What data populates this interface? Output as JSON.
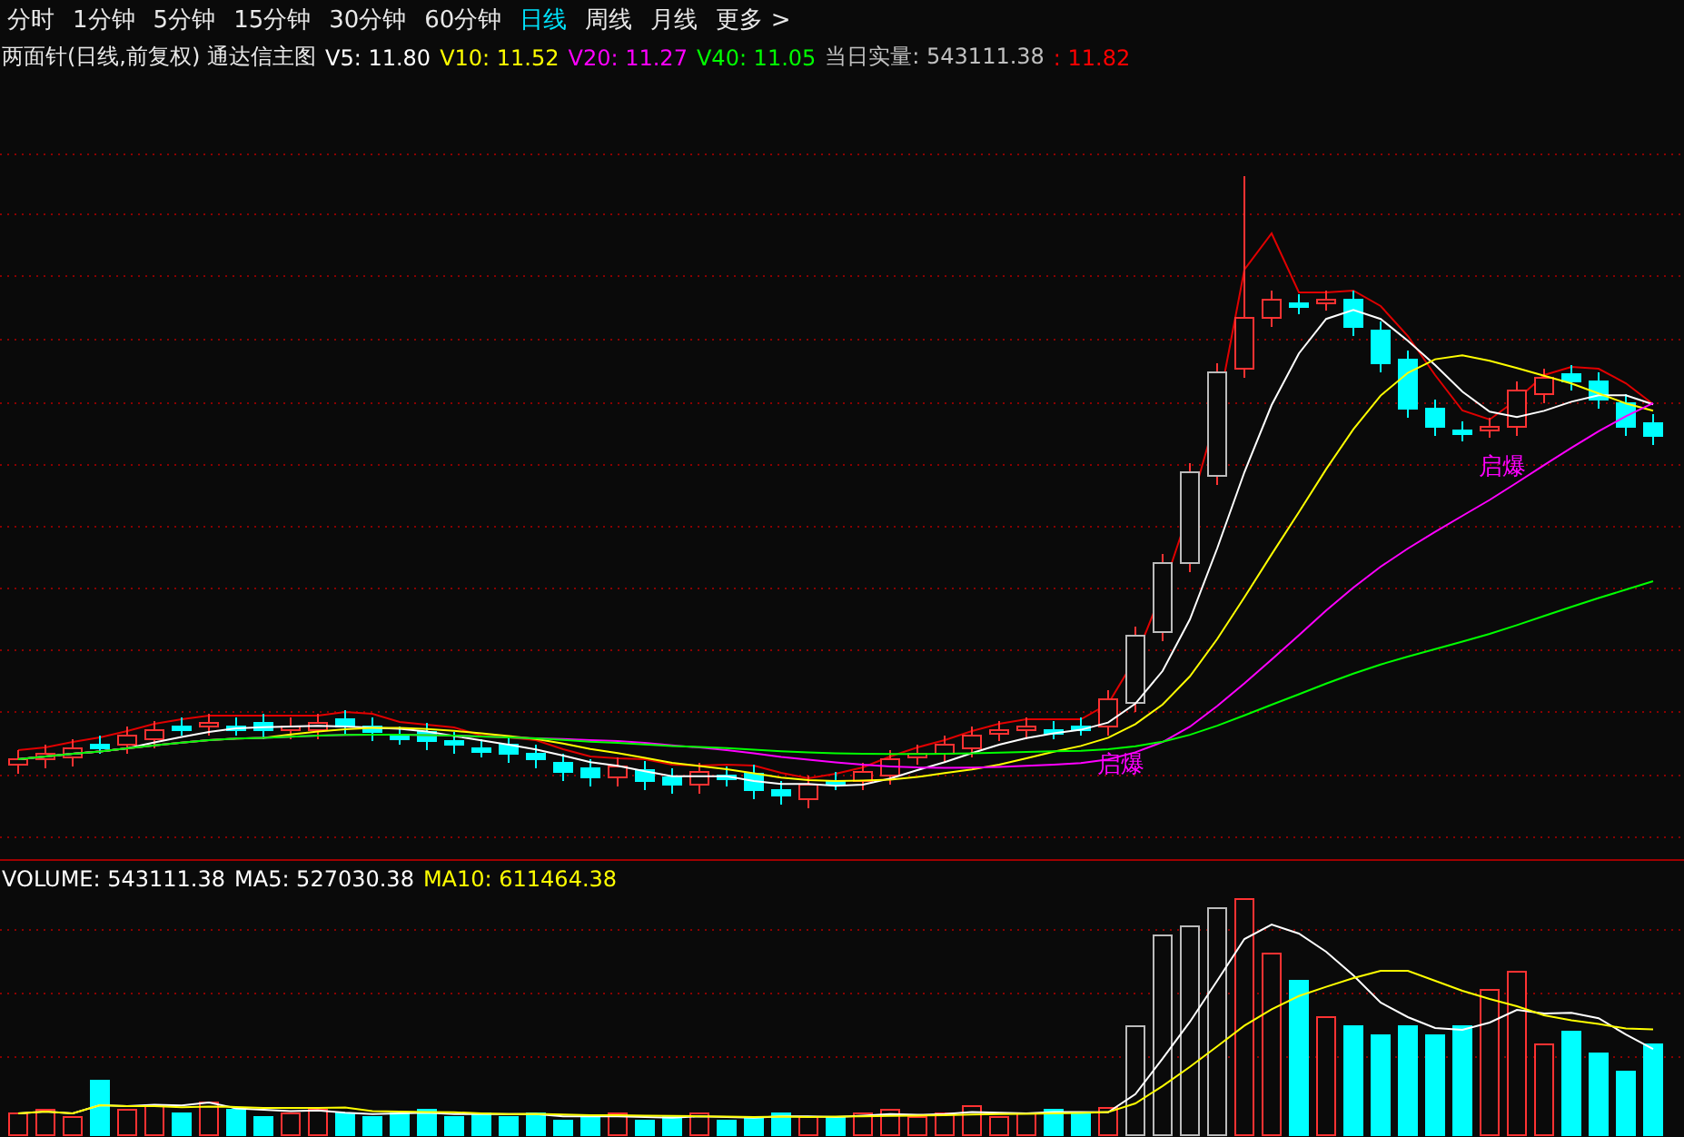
{
  "periods": [
    {
      "label": "分时",
      "selected": false
    },
    {
      "label": "1分钟",
      "selected": false
    },
    {
      "label": "5分钟",
      "selected": false
    },
    {
      "label": "15分钟",
      "selected": false
    },
    {
      "label": "30分钟",
      "selected": false
    },
    {
      "label": "60分钟",
      "selected": false
    },
    {
      "label": "日线",
      "selected": true
    },
    {
      "label": "周线",
      "selected": false
    },
    {
      "label": "月线",
      "selected": false
    },
    {
      "label": "更多 >",
      "selected": false
    }
  ],
  "main_chart": {
    "title": "两面针(日线,前复权) 通达信主图",
    "indicators": [
      {
        "label": "V5: 11.80",
        "color": "#ffffff"
      },
      {
        "label": "V10: 11.52",
        "color": "#ffff00"
      },
      {
        "label": "V20: 11.27",
        "color": "#ff00ff"
      },
      {
        "label": "V40: 11.05",
        "color": "#00ff00"
      },
      {
        "label": "当日实量: 543111.38",
        "color": "#c0c0c0"
      },
      {
        "label": ": 11.82",
        "color": "#ff0000"
      }
    ],
    "markers": [
      {
        "label": "启爆"
      },
      {
        "label": "启爆"
      }
    ]
  },
  "volume_chart": {
    "indicators": [
      {
        "label": "VOLUME: 543111.38",
        "color": "#ffffff"
      },
      {
        "label": "MA5: 527030.38",
        "color": "#ffffff"
      },
      {
        "label": "MA10: 611464.38",
        "color": "#ffff00"
      }
    ]
  }
}
